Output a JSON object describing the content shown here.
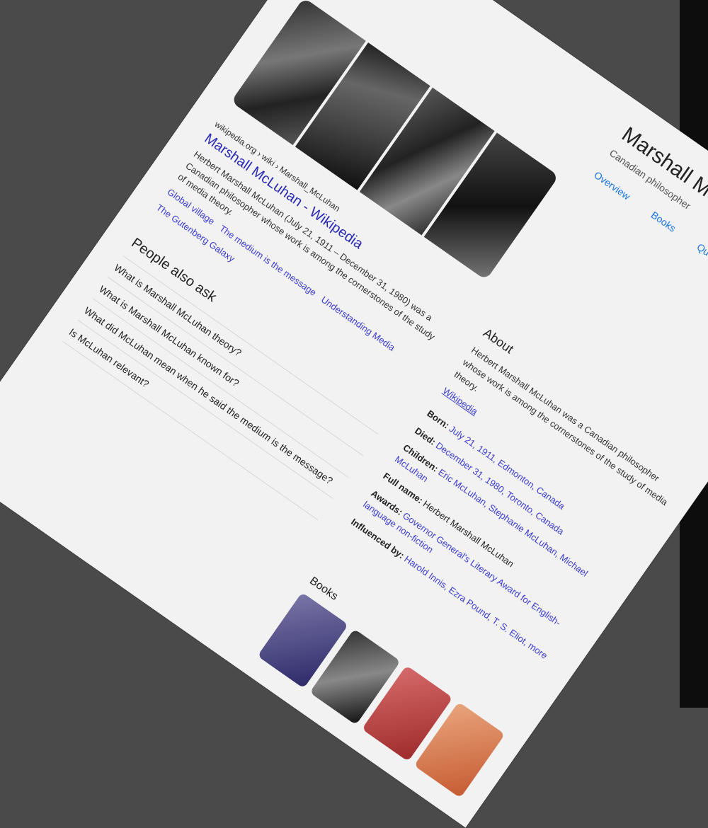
{
  "knowledge_panel": {
    "title": "Marshall McLuhan",
    "subtitle": "Canadian philosopher",
    "actions": [
      "Overview",
      "Books",
      "Quotes"
    ]
  },
  "search_result": {
    "cite": "wikipedia.org › wiki › Marshall_McLuhan",
    "title": "Marshall McLuhan - Wikipedia",
    "snippet": "Herbert Marshall McLuhan (July 21, 1911 – December 31, 1980) was a Canadian philosopher whose work is among the cornerstones of the study of media theory.",
    "sitelinks": [
      "Global village",
      "The medium is the message",
      "Understanding Media",
      "The Gutenberg Galaxy"
    ]
  },
  "people_also_ask": {
    "title": "People also ask",
    "questions": [
      "What is Marshall McLuhan theory?",
      "What is Marshall McLuhan known for?",
      "What did McLuhan mean when he said the medium is the message?",
      "Is McLuhan relevant?"
    ]
  },
  "about": {
    "heading": "About",
    "text": "Herbert Marshall McLuhan was a Canadian philosopher whose work is among the cornerstones of the study of media theory.",
    "source": "Wikipedia"
  },
  "facts": [
    {
      "k": "Born:",
      "v": "July 21, 1911, Edmonton, Canada"
    },
    {
      "k": "Died:",
      "v": "December 31, 1980, Toronto, Canada"
    },
    {
      "k": "Children:",
      "v": "Eric McLuhan, Stephanie McLuhan, Michael McLuhan"
    },
    {
      "k": "Full name:",
      "v": "Herbert Marshall McLuhan"
    },
    {
      "k": "Awards:",
      "v": "Governor General's Literary Award for English-language non-fiction"
    },
    {
      "k": "Influenced by:",
      "v": "Harold Innis, Ezra Pound, T. S. Eliot, more"
    }
  ],
  "books": {
    "heading": "Books"
  },
  "colors": {
    "link": "#3b3bd1",
    "accent": "#1a73e8"
  }
}
